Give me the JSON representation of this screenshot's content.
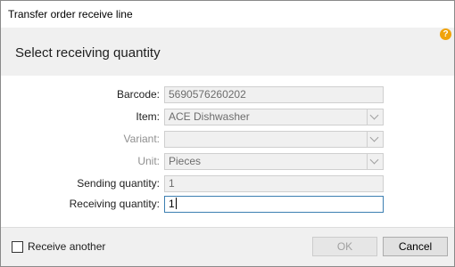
{
  "window": {
    "title": "Transfer order receive line"
  },
  "header": {
    "heading": "Select receiving quantity",
    "help_icon": "question-mark"
  },
  "colors": {
    "help_icon": "#f0a30a",
    "header_bg": "#f0f0f0",
    "active_border": "#3c7fb1"
  },
  "form": {
    "barcode": {
      "label": "Barcode:",
      "value": "5690576260202"
    },
    "item": {
      "label": "Item:",
      "value": "ACE Dishwasher"
    },
    "variant": {
      "label": "Variant:",
      "value": ""
    },
    "unit": {
      "label": "Unit:",
      "value": "Pieces"
    },
    "sending_quantity": {
      "label": "Sending quantity:",
      "value": "1"
    },
    "receiving_quantity": {
      "label": "Receiving quantity:",
      "value": "1"
    }
  },
  "footer": {
    "receive_another_label": "Receive another",
    "receive_another_checked": false,
    "ok_label": "OK",
    "cancel_label": "Cancel"
  }
}
